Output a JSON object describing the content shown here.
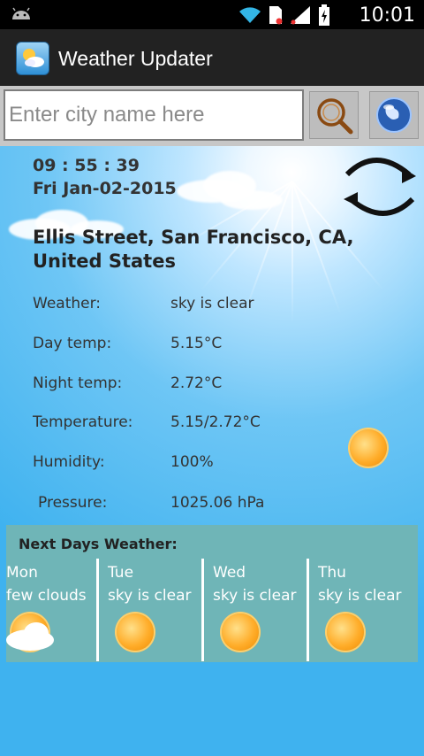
{
  "status_bar": {
    "time": "10:01",
    "icons": [
      "android-icon",
      "wifi-icon",
      "sim-icon",
      "signal-icon",
      "battery-icon"
    ]
  },
  "app": {
    "title": "Weather Updater",
    "icon": "weather-app-icon"
  },
  "search": {
    "placeholder": "Enter city name here",
    "value": "",
    "search_icon": "search-magnifier-icon",
    "globe_icon": "globe-icon"
  },
  "current": {
    "time": "09 : 55 : 39",
    "date": "Fri Jan-02-2015",
    "location": "Ellis Street, San Francisco, CA, United States",
    "refresh_icon": "refresh-arrows-icon",
    "rows": [
      {
        "label": "Weather:",
        "value": "sky is clear"
      },
      {
        "label": "Day temp:",
        "value": "5.15°C"
      },
      {
        "label": "Night temp:",
        "value": "2.72°C"
      },
      {
        "label": "Temperature:",
        "value": "5.15/2.72°C"
      },
      {
        "label": "Humidity:",
        "value": "100%"
      },
      {
        "label": "Pressure:",
        "value": "1025.06 hPa"
      }
    ],
    "condition_icon": "sun-icon"
  },
  "forecast": {
    "title": "Next Days Weather:",
    "days": [
      {
        "day": "Mon",
        "desc": "few clouds",
        "icon": "sun-cloud-icon"
      },
      {
        "day": "Tue",
        "desc": "sky is clear",
        "icon": "sun-icon"
      },
      {
        "day": "Wed",
        "desc": "sky is clear",
        "icon": "sun-icon"
      },
      {
        "day": "Thu",
        "desc": "sky is clear",
        "icon": "sun-icon"
      }
    ]
  },
  "colors": {
    "sky": "#3fb2ef",
    "panel": "#6fb5b7",
    "actionbar": "#222222"
  }
}
